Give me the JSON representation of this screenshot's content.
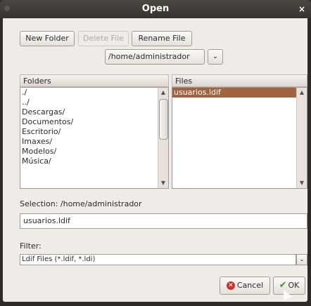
{
  "window": {
    "title": "Open",
    "close_glyph": "×"
  },
  "toolbar": {
    "new_folder": "New Folder",
    "delete_file": "Delete File",
    "rename_file": "Rename File"
  },
  "path": {
    "current": "/home/administrador",
    "arrow": "⌄"
  },
  "folders": {
    "header": "Folders",
    "items": [
      "./",
      "../",
      "Descargas/",
      "Documentos/",
      "Escritorio/",
      "Imaxes/",
      "Modelos/",
      "Música/"
    ]
  },
  "files": {
    "header": "Files",
    "items": [
      "usuarios.ldif"
    ],
    "selected_index": 0
  },
  "selection": {
    "label": "Selection: /home/administrador",
    "value": "usuarios.ldif"
  },
  "filter": {
    "label": "Filter:",
    "value": "Ldif Files (*.ldif, *.ldi)"
  },
  "buttons": {
    "cancel": "Cancel",
    "ok": "OK"
  },
  "colors": {
    "selection": "#a2633e",
    "titlebar": "#3e3a36",
    "dialog_bg": "#efebe7"
  }
}
